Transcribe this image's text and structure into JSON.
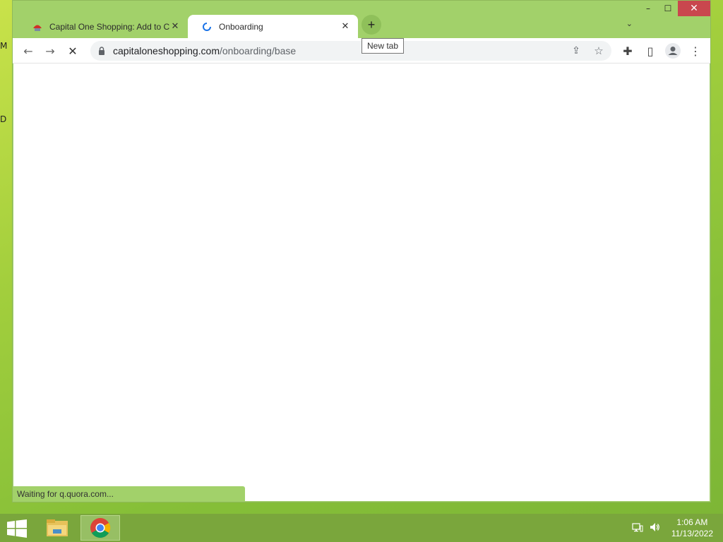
{
  "desktop": {
    "glyph_top": "M",
    "glyph_mid": "D"
  },
  "window": {
    "controls": {
      "minimize": "–",
      "maximize": "☐",
      "close": "✕"
    }
  },
  "tabs": [
    {
      "title": "Capital One Shopping: Add to Ch",
      "close": "✕",
      "icon": "capital-one-favicon",
      "active": false
    },
    {
      "title": "Onboarding",
      "close": "✕",
      "icon": "loading-spinner",
      "active": true
    }
  ],
  "newtab": {
    "label": "+",
    "tooltip": "New tab"
  },
  "tabsearch": {
    "label": "⌄"
  },
  "toolbar": {
    "back": "←",
    "forward": "→",
    "stop": "✕",
    "url_domain": "capitaloneshopping.com",
    "url_path": "/onboarding/base",
    "share": "⇪",
    "bookmark": "☆",
    "extensions": "✚",
    "sidepanel": "▯",
    "menu": "⋮"
  },
  "status": {
    "text": "Waiting for q.quora.com..."
  },
  "taskbar": {
    "time": "1:06 AM",
    "date": "11/13/2022"
  },
  "colors": {
    "accent": "#1a73e8",
    "close_red": "#c9474e",
    "frame": "#a2d16a"
  }
}
